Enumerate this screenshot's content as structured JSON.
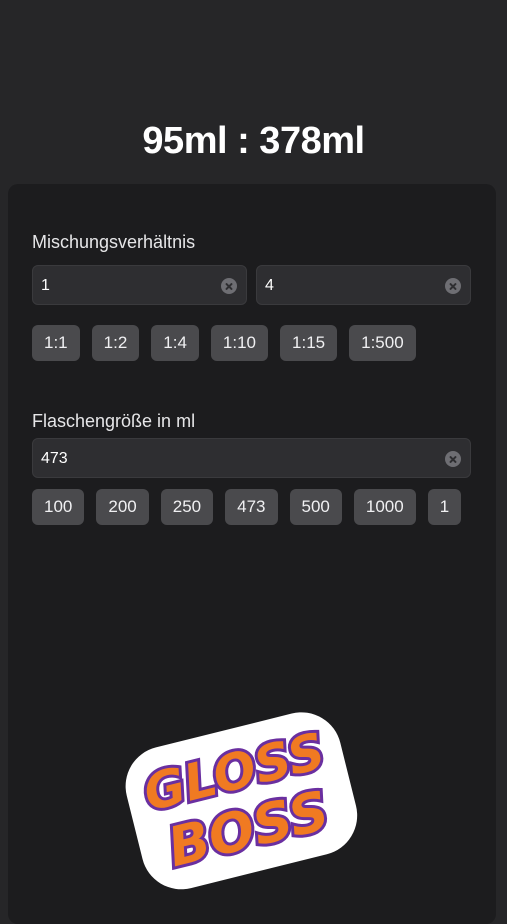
{
  "result": "95ml : 378ml",
  "ratio": {
    "label": "Mischungsverhältnis",
    "left_value": "1",
    "right_value": "4",
    "presets": [
      "1:1",
      "1:2",
      "1:4",
      "1:10",
      "1:15",
      "1:500"
    ]
  },
  "bottle": {
    "label": "Flaschengröße in ml",
    "value": "473",
    "presets": [
      "100",
      "200",
      "250",
      "473",
      "500",
      "1000",
      "1"
    ]
  },
  "logo": {
    "line1": "GLOSS",
    "line2": "BOSS",
    "colors": {
      "fill": "#f07a22",
      "outline": "#6a2fa0",
      "border": "#ffffff"
    }
  },
  "icons": {
    "clear": "clear-circle-icon"
  }
}
